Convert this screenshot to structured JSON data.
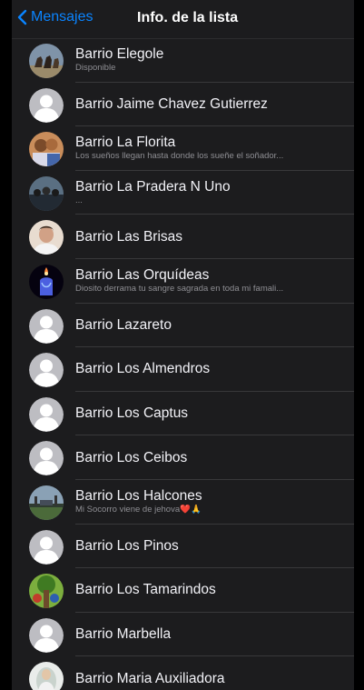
{
  "nav": {
    "back_label": "Mensajes",
    "title": "Info. de la lista"
  },
  "rows": [
    {
      "name": "Barrio Elegole",
      "subtitle": "Disponible",
      "avatar": "photo-horses"
    },
    {
      "name": "Barrio Jaime Chavez Gutierrez",
      "subtitle": "",
      "avatar": "default-person"
    },
    {
      "name": "Barrio La Florita",
      "subtitle": "Los sueños llegan hasta donde los sueñe el soñador...",
      "avatar": "photo-people"
    },
    {
      "name": "Barrio La Pradera N Uno",
      "subtitle": "...",
      "avatar": "photo-group"
    },
    {
      "name": "Barrio Las Brisas",
      "subtitle": "",
      "avatar": "photo-man"
    },
    {
      "name": "Barrio Las Orquídeas",
      "subtitle": "Diosito derrama tu sangre sagrada en toda mi famali...",
      "avatar": "photo-candle"
    },
    {
      "name": "Barrio Lazareto",
      "subtitle": "",
      "avatar": "default-person"
    },
    {
      "name": "Barrio Los Almendros",
      "subtitle": "",
      "avatar": "default-person"
    },
    {
      "name": "Barrio Los Captus",
      "subtitle": "",
      "avatar": "default-person"
    },
    {
      "name": "Barrio Los Ceibos",
      "subtitle": "",
      "avatar": "default-person"
    },
    {
      "name": "Barrio Los Halcones",
      "subtitle": "Mi Socorro viene de jehova",
      "emoji": "❤️🙏",
      "avatar": "photo-field"
    },
    {
      "name": "Barrio Los Pinos",
      "subtitle": "",
      "avatar": "default-person"
    },
    {
      "name": "Barrio Los Tamarindos",
      "subtitle": "",
      "avatar": "photo-tree"
    },
    {
      "name": "Barrio Marbella",
      "subtitle": "",
      "avatar": "default-person"
    },
    {
      "name": "Barrio Maria Auxiliadora",
      "subtitle": "",
      "avatar": "photo-saint"
    }
  ],
  "colors": {
    "accent": "#0a84ff",
    "background": "#1c1c1e",
    "separator": "#38383a"
  }
}
